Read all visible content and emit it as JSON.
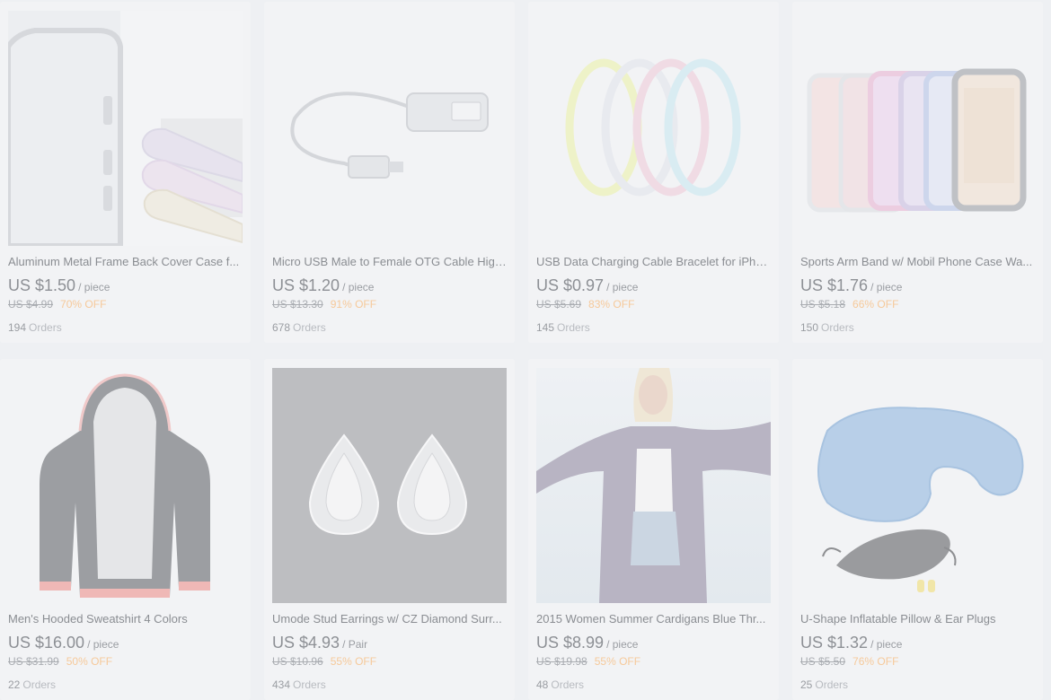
{
  "products": [
    {
      "title": "Aluminum Metal Frame Back Cover Case f...",
      "price": "US $1.50",
      "unit": "/ piece",
      "original": "US $4.99",
      "discount": "70% OFF",
      "orders": "194",
      "orders_label": "Orders"
    },
    {
      "title": "Micro USB Male to Female OTG Cable High...",
      "price": "US $1.20",
      "unit": "/ piece",
      "original": "US $13.30",
      "discount": "91% OFF",
      "orders": "678",
      "orders_label": "Orders"
    },
    {
      "title": "USB Data Charging Cable Bracelet for iPho...",
      "price": "US $0.97",
      "unit": "/ piece",
      "original": "US $5.69",
      "discount": "83% OFF",
      "orders": "145",
      "orders_label": "Orders"
    },
    {
      "title": "Sports Arm Band w/ Mobil Phone Case Wa...",
      "price": "US $1.76",
      "unit": "/ piece",
      "original": "US $5.18",
      "discount": "66% OFF",
      "orders": "150",
      "orders_label": "Orders"
    },
    {
      "title": "Men's Hooded Sweatshirt 4 Colors",
      "price": "US $16.00",
      "unit": "/ piece",
      "original": "US $31.99",
      "discount": "50% OFF",
      "orders": "22",
      "orders_label": "Orders"
    },
    {
      "title": "Umode Stud Earrings w/ CZ Diamond Surr...",
      "price": "US $4.93",
      "unit": "/ Pair",
      "original": "US $10.96",
      "discount": "55% OFF",
      "orders": "434",
      "orders_label": "Orders"
    },
    {
      "title": "2015 Women Summer Cardigans Blue Thr...",
      "price": "US $8.99",
      "unit": "/ piece",
      "original": "US $19.98",
      "discount": "55% OFF",
      "orders": "48",
      "orders_label": "Orders"
    },
    {
      "title": "U-Shape Inflatable Pillow & Ear Plugs",
      "price": "US $1.32",
      "unit": "/ piece",
      "original": "US $5.50",
      "discount": "76% OFF",
      "orders": "25",
      "orders_label": "Orders"
    }
  ]
}
